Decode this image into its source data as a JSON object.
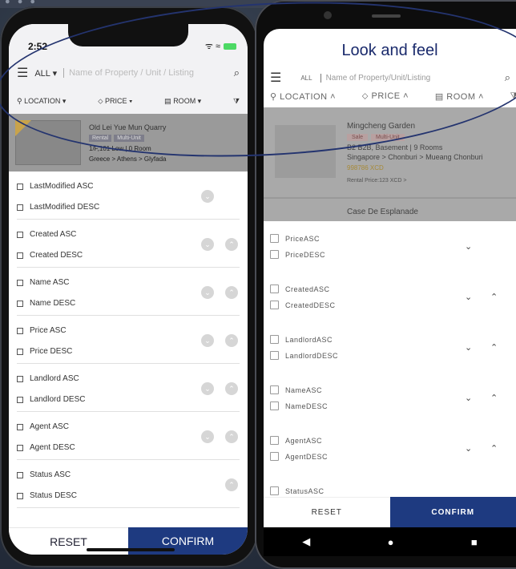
{
  "left_phone": {
    "status": {
      "time": "2:52",
      "icons": "ᯤ ≈"
    },
    "search": {
      "scope": "ALL ▾",
      "placeholder": "Name of Property / Unit / Listing"
    },
    "filters": [
      "LOCATION ▾",
      "PRICE ▾",
      "ROOM ▾"
    ],
    "listing": {
      "title": "Old Lei Yue Mun Quarry",
      "tags": [
        "Rental",
        "Multi-Unit"
      ],
      "unit": "1/F,101 Low | 0 Room",
      "location": "Greece > Athens > Glyfada"
    },
    "sort_groups": [
      {
        "asc": "LastModified ASC",
        "desc": "LastModified DESC"
      },
      {
        "asc": "Created ASC",
        "desc": "Created DESC"
      },
      {
        "asc": "Name ASC",
        "desc": "Name DESC"
      },
      {
        "asc": "Price ASC",
        "desc": "Price DESC"
      },
      {
        "asc": "Landlord ASC",
        "desc": "Landlord DESC"
      },
      {
        "asc": "Agent ASC",
        "desc": "Agent DESC"
      },
      {
        "asc": "Status ASC",
        "desc": "Status DESC"
      }
    ],
    "reset_label": "RESET",
    "confirm_label": "CONFIRM"
  },
  "right_phone": {
    "title": "Look and feel",
    "search": {
      "scope": "ALL",
      "placeholder": "Name of Property/Unit/Listing"
    },
    "filters": [
      "LOCATION ˄",
      "PRICE ˄",
      "ROOM ˄"
    ],
    "listing": {
      "name": "Mingcheng Garden",
      "tags": [
        "Sale",
        "Multi-Unit"
      ],
      "unit": "B2 B2B, Basement | 9 Rooms",
      "location": "Singapore > Chonburi > Mueang Chonburi",
      "price": "998786 XCD",
      "rental_price": "Rental Price:123 XCD >",
      "next_name": "Case De Esplanade"
    },
    "sort_groups": [
      {
        "asc": "PriceASC",
        "desc": "PriceDESC"
      },
      {
        "asc": "CreatedASC",
        "desc": "CreatedDESC"
      },
      {
        "asc": "LandlordASC",
        "desc": "LandlordDESC"
      },
      {
        "asc": "NameASC",
        "desc": "NameDESC"
      },
      {
        "asc": "AgentASC",
        "desc": "AgentDESC"
      },
      {
        "asc": "StatusASC",
        "desc": ""
      }
    ],
    "reset_label": "RESET",
    "confirm_label": "CONFIRM"
  },
  "colors": {
    "accent": "#1e3a80",
    "annotation_oval": "#24346f"
  }
}
